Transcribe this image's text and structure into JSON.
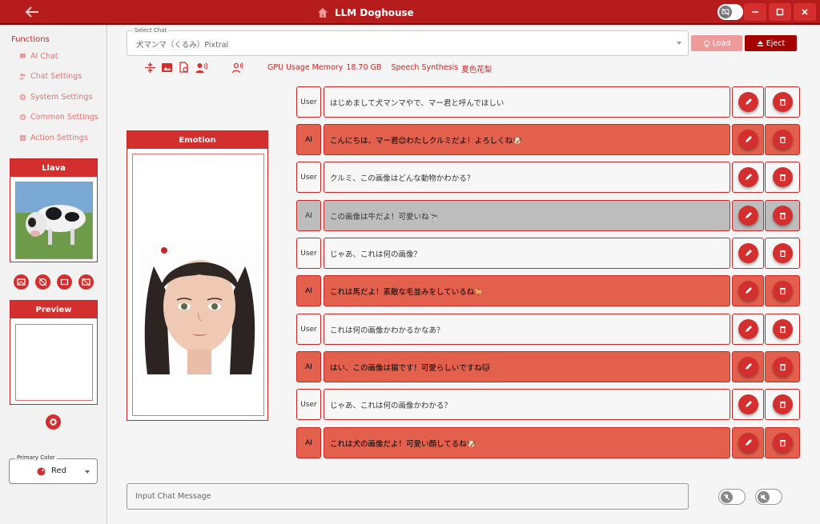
{
  "app": {
    "title": "LLM Doghouse"
  },
  "sidebar": {
    "heading": "Functions",
    "items": [
      {
        "label": "AI Chat",
        "icon": "chat-icon"
      },
      {
        "label": "Chat Settings",
        "icon": "people-icon"
      },
      {
        "label": "System Settings",
        "icon": "gear-icon"
      },
      {
        "label": "Common Settings",
        "icon": "gear-icon"
      },
      {
        "label": "Action Settings",
        "icon": "action-icon"
      }
    ],
    "llava_panel_title": "Llava",
    "preview_panel_title": "Preview",
    "primary_color_label": "Primary Color",
    "primary_color_value": "Red"
  },
  "topbar": {
    "select_chat_label": "Select Chat",
    "select_chat_value": "犬マンマ（くるみ）Pixtral",
    "load_label": "Load",
    "eject_label": "Eject",
    "gpu_label": "GPU Usage Memory",
    "gpu_value": "18.70 GB",
    "speech_label": "Speech Synthesis",
    "speech_value": "夏色花梨"
  },
  "emotion": {
    "title": "Emotion"
  },
  "messages": [
    {
      "role": "User",
      "text": "はじめまして犬マンマやで、マー君と呼んでほしい"
    },
    {
      "role": "AI",
      "text": "こんにちは、マー君😊わたしクルミだよ！よろしくね🐶"
    },
    {
      "role": "User",
      "text": "クルミ、この画像はどんな動物かわかる？"
    },
    {
      "role": "AI",
      "text": "この画像は牛だよ！可愛いね🐄"
    },
    {
      "role": "User",
      "text": "じゃあ、これは何の画像？"
    },
    {
      "role": "AI",
      "text": "これは馬だよ！素敵な毛並みをしているね🐎"
    },
    {
      "role": "User",
      "text": "これは何の画像かわかるかなあ？"
    },
    {
      "role": "AI",
      "text": "はい、この画像は猫です！可愛らしいですね🐱"
    },
    {
      "role": "User",
      "text": "じゃあ、これは何の画像かわかる？"
    },
    {
      "role": "AI",
      "text": "これは犬の画像だよ！可愛い顔してるね🐶"
    }
  ],
  "input": {
    "placeholder": "Input Chat Message"
  },
  "colors": {
    "accent": "#d32f2f",
    "titlebar": "#b71c1c",
    "ai_row": "#e2604c",
    "selected_row": "#bdbdbd"
  }
}
